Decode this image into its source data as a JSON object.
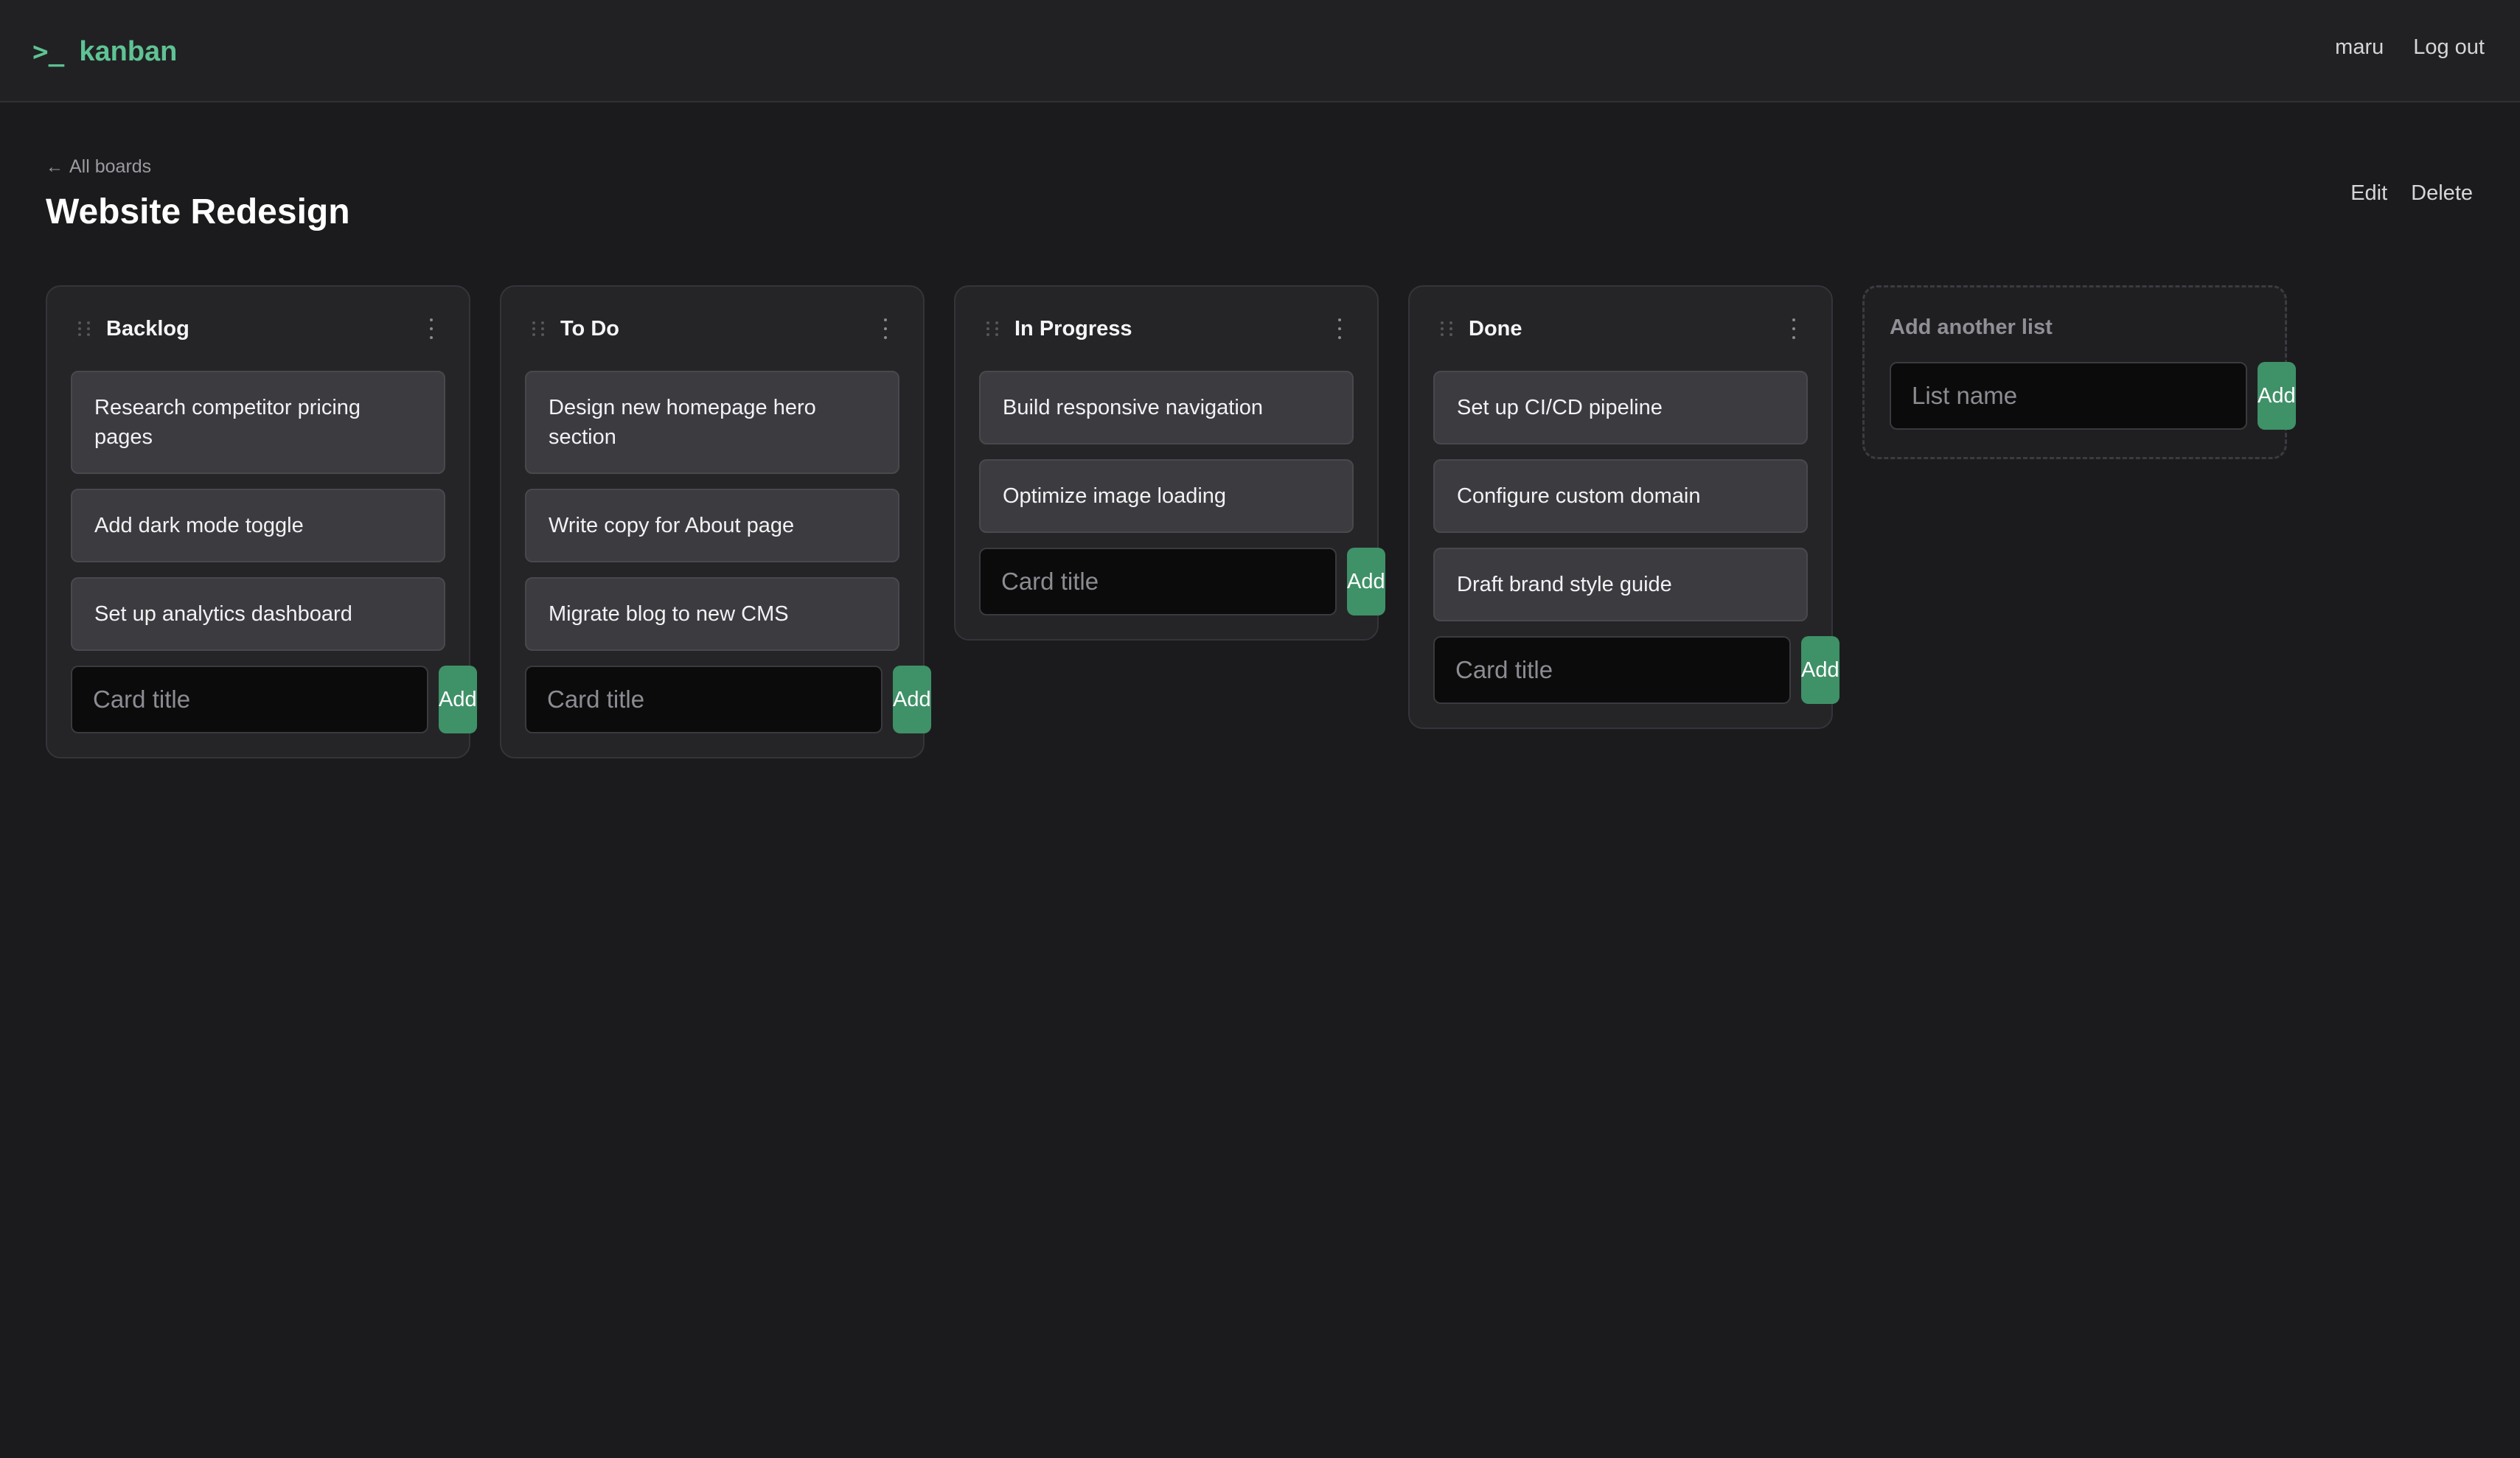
{
  "header": {
    "prompt": ">_",
    "brand": "kanban",
    "username": "maru",
    "logout_label": "Log out"
  },
  "board": {
    "back_label": "All boards",
    "title": "Website Redesign",
    "edit_label": "Edit",
    "delete_label": "Delete"
  },
  "lists": [
    {
      "name": "Backlog",
      "cards": [
        "Research competitor pricing pages",
        "Add dark mode toggle",
        "Set up analytics dashboard"
      ]
    },
    {
      "name": "To Do",
      "cards": [
        "Design new homepage hero section",
        "Write copy for About page",
        "Migrate blog to new CMS"
      ]
    },
    {
      "name": "In Progress",
      "cards": [
        "Build responsive navigation",
        "Optimize image loading"
      ]
    },
    {
      "name": "Done",
      "cards": [
        "Set up CI/CD pipeline",
        "Configure custom domain",
        "Draft brand style guide"
      ]
    }
  ],
  "card_form": {
    "placeholder": "Card title",
    "add_label": "Add"
  },
  "new_list": {
    "label": "Add another list",
    "placeholder": "List name",
    "add_label": "Add"
  },
  "colors": {
    "accent": "#3f9168",
    "brand": "#5fc394",
    "background": "#1b1b1d"
  },
  "icons": {
    "back": "arrow-left-icon",
    "grip": "drag-handle-icon",
    "menu": "more-vertical-icon"
  }
}
